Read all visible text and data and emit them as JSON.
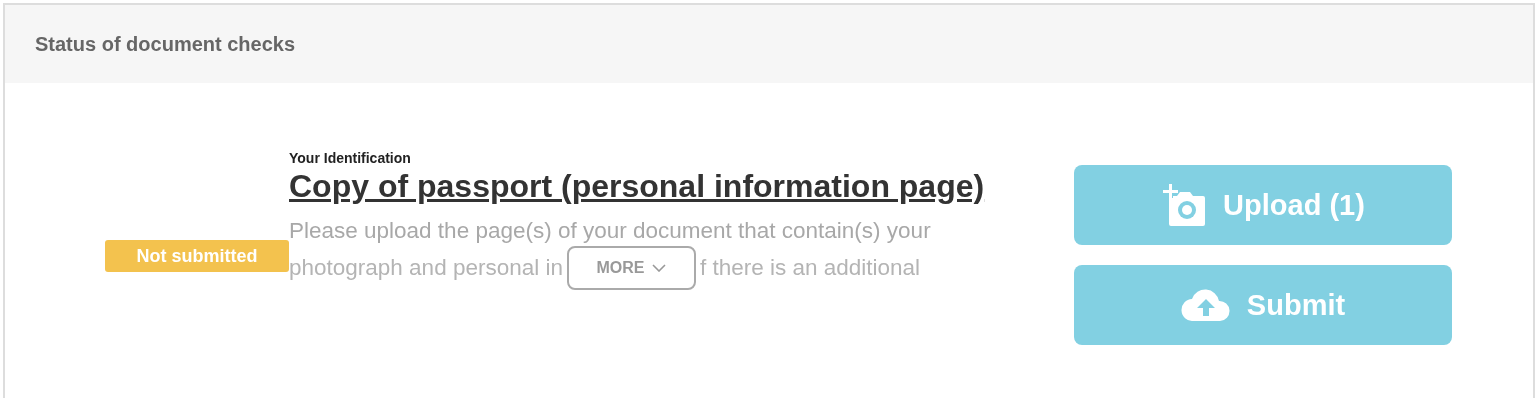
{
  "panel": {
    "title": "Status of document checks"
  },
  "document": {
    "status": {
      "label": "Not submitted",
      "kind": "pending"
    },
    "category": "Your Identification",
    "title": "Copy of passport (personal information page)",
    "description_lines": [
      [
        "Please upload the page(s) of your document that contain(s) your"
      ],
      [
        "photograph and personal in",
        "f there is an additional"
      ]
    ],
    "more_button": "MORE",
    "buttons": [
      {
        "label": "Upload (1)",
        "kind": "upload"
      },
      {
        "label": "Submit",
        "kind": "submit"
      }
    ]
  }
}
